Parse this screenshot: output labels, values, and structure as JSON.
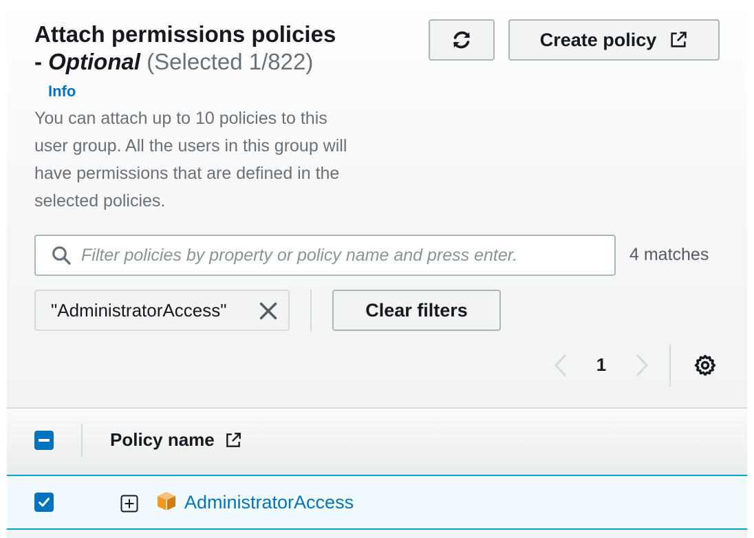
{
  "header": {
    "title": "Attach permissions policies",
    "title_dash": "- ",
    "optional": "Optional",
    "selected": "(Selected 1/822)",
    "info_link": "Info",
    "description": "You can attach up to 10 policies to this user group. All the users in this group will have permissions that are defined in the selected policies."
  },
  "actions": {
    "refresh_icon": "refresh-icon",
    "create_label": "Create policy",
    "external_icon": "external-link-icon"
  },
  "filter": {
    "placeholder": "Filter policies by property or policy name and press enter.",
    "value": "",
    "matches": "4 matches",
    "token": "\"AdministratorAccess\"",
    "clear_label": "Clear filters"
  },
  "pagination": {
    "current_page": "1",
    "settings_icon": "gear-icon"
  },
  "table": {
    "column_header": "Policy name",
    "rows": [
      {
        "name": "AdministratorAccess",
        "selected": true,
        "icon": "aws-managed-cube-icon"
      }
    ]
  },
  "colors": {
    "link": "#0073bb",
    "checkbox": "#0073bb",
    "selected_row_bg": "#f1faff",
    "selected_row_border": "#00a1c9",
    "aws_orange": "#ec9b20"
  }
}
